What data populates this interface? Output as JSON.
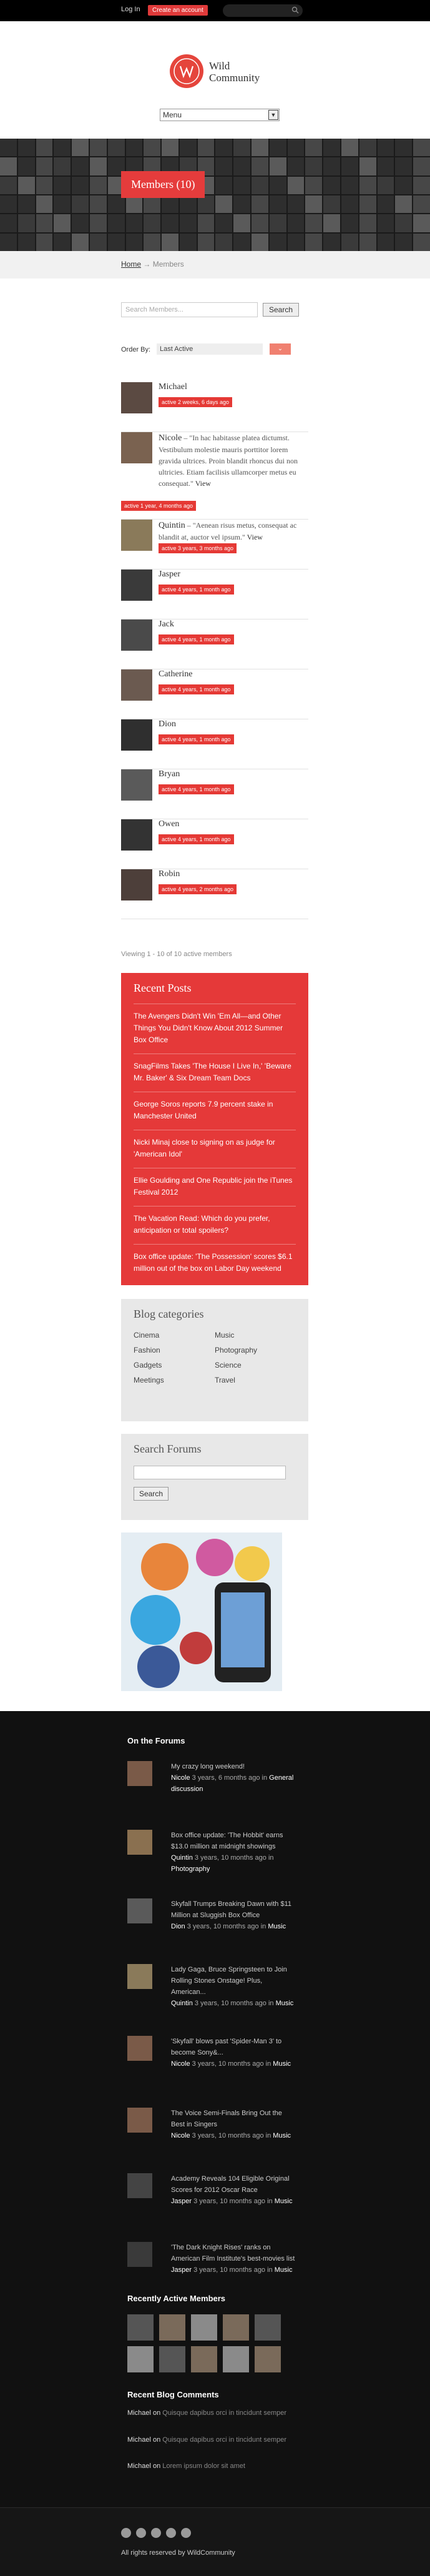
{
  "adminbar": {
    "login": "Log In",
    "create": "Create an account"
  },
  "site": {
    "name_line1": "Wild",
    "name_line2": "Community"
  },
  "menu": {
    "selected": "Menu"
  },
  "banner": {
    "title": "Members (10)"
  },
  "breadcrumb": {
    "home": "Home",
    "sep": "→",
    "current": "Members"
  },
  "search": {
    "placeholder": "Search Members...",
    "button": "Search"
  },
  "order": {
    "label": "Order By:",
    "selected": "Last Active",
    "button_icon": "chevron-down-icon"
  },
  "members": [
    {
      "name": "Michael",
      "active": "active 2 weeks, 6 days ago",
      "quote": ""
    },
    {
      "name": "Nicole",
      "active": "active 1 year, 4 months ago",
      "quote": "\"In hac habitasse platea dictumst. Vestibulum molestie mauris porttitor lorem gravida ultrices. Proin blandit rhoncus dui non ultricies. Etiam facilisis ullamcorper metus eu consequat.\"",
      "view": "View"
    },
    {
      "name": "Quintin",
      "active": "active 3 years, 3 months ago",
      "quote": "\"Aenean risus metus, consequat ac blandit at, auctor vel ipsum.\"",
      "view": "View"
    },
    {
      "name": "Jasper",
      "active": "active 4 years, 1 month ago",
      "quote": ""
    },
    {
      "name": "Jack",
      "active": "active 4 years, 1 month ago",
      "quote": ""
    },
    {
      "name": "Catherine",
      "active": "active 4 years, 1 month ago",
      "quote": ""
    },
    {
      "name": "Dion",
      "active": "active 4 years, 1 month ago",
      "quote": ""
    },
    {
      "name": "Bryan",
      "active": "active 4 years, 1 month ago",
      "quote": ""
    },
    {
      "name": "Owen",
      "active": "active 4 years, 1 month ago",
      "quote": ""
    },
    {
      "name": "Robin",
      "active": "active 4 years, 2 months ago",
      "quote": ""
    }
  ],
  "viewing": "Viewing 1 - 10 of 10 active members",
  "recent_posts": {
    "title": "Recent Posts",
    "items": [
      "The Avengers Didn't Win 'Em All—and Other Things You Didn't Know About 2012 Summer Box Office",
      "SnagFilms Takes 'The House I Live In,' 'Beware Mr. Baker' & Six Dream Team Docs",
      "George Soros reports 7.9 percent stake in Manchester United",
      "Nicki Minaj close to signing on as judge for 'American Idol'",
      "Ellie Goulding and One Republic join the iTunes Festival 2012",
      "The Vacation Read: Which do you prefer, anticipation or total spoilers?",
      "Box office update: 'The Possession' scores $6.1 million out of the box on Labor Day weekend"
    ]
  },
  "blog_categories": {
    "title": "Blog categories",
    "items": [
      "Cinema",
      "Music",
      "Fashion",
      "Photography",
      "Gadgets",
      "Science",
      "Meetings",
      "Travel"
    ]
  },
  "search_forums": {
    "title": "Search Forums",
    "button": "Search"
  },
  "footer": {
    "forums_title": "On the Forums",
    "forums": [
      {
        "topic": "My crazy long weekend!",
        "user": "Nicole",
        "when": "3 years, 6 months ago",
        "in": "in",
        "forum": "General discussion"
      },
      {
        "topic": "Box office update: 'The Hobbit' earns $13.0 million at midnight showings",
        "user": "Quintin",
        "when": "3 years, 10 months ago",
        "in": "in",
        "forum": "Photography"
      },
      {
        "topic": "Skyfall Trumps Breaking Dawn with $11 Million at Sluggish Box Office",
        "user": "Dion",
        "when": "3 years, 10 months ago",
        "in": "in",
        "forum": "Music"
      },
      {
        "topic": "Lady Gaga, Bruce Springsteen to Join Rolling Stones Onstage! Plus, American...",
        "user": "Quintin",
        "when": "3 years, 10 months ago",
        "in": "in",
        "forum": "Music"
      },
      {
        "topic": "'Skyfall' blows past 'Spider-Man 3' to become Sony&...",
        "user": "Nicole",
        "when": "3 years, 10 months ago",
        "in": "in",
        "forum": "Music"
      },
      {
        "topic": "The Voice Semi-Finals Bring Out the Best in Singers",
        "user": "Nicole",
        "when": "3 years, 10 months ago",
        "in": "in",
        "forum": "Music"
      },
      {
        "topic": "Academy Reveals 104 Eligible Original Scores for 2012 Oscar Race",
        "user": "Jasper",
        "when": "3 years, 10 months ago",
        "in": "in",
        "forum": "Music"
      },
      {
        "topic": "'The Dark Knight Rises' ranks on American Film Institute's best-movies list",
        "user": "Jasper",
        "when": "3 years, 10 months ago",
        "in": "in",
        "forum": "Music"
      }
    ],
    "recent_members_title": "Recently Active Members",
    "comments_title": "Recent Blog Comments",
    "comments": [
      {
        "author": "Michael",
        "on": "on",
        "post": "Quisque dapibus orci in tincidunt semper"
      },
      {
        "author": "Michael",
        "on": "on",
        "post": "Quisque dapibus orci in tincidunt semper"
      },
      {
        "author": "Michael",
        "on": "on",
        "post": "Lorem ipsum dolor sit amet"
      }
    ],
    "socials": [
      "facebook-icon",
      "twitter-icon",
      "google-plus-icon",
      "pinterest-icon",
      "tumblr-icon"
    ],
    "copyright": "All rights reserved by WildCommunity"
  },
  "colors": {
    "accent": "#e53939",
    "footer_bg": "#111111",
    "widget_grey": "#e8e8e8"
  }
}
